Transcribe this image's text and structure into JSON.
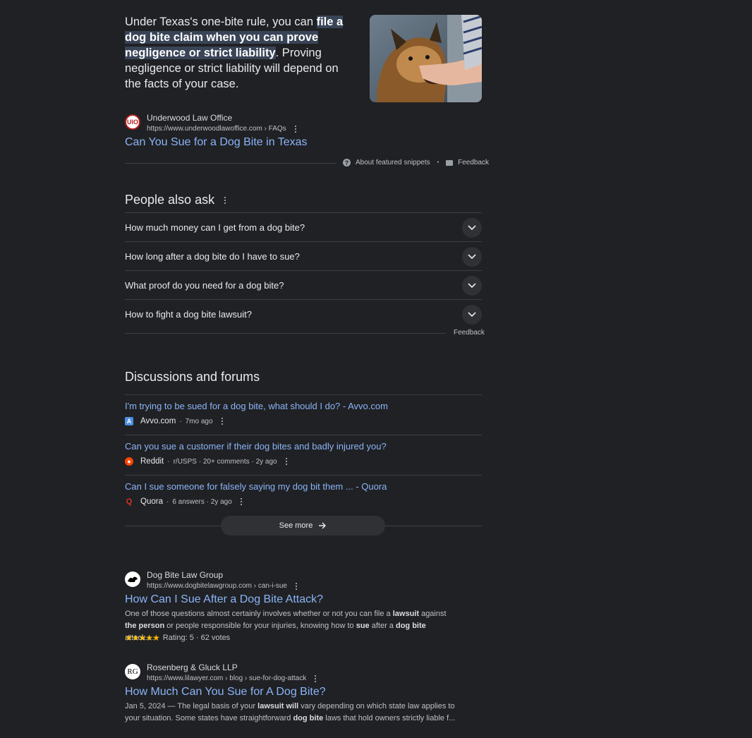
{
  "featured_snippet": {
    "text_before": "Under Texas's one-bite rule, you can ",
    "highlight": "file a dog bite claim when you can prove negligence or strict liability",
    "text_after": ". Proving negligence or strict liability will depend on the facts of your case.",
    "image_alt": "dog-photo",
    "source_name": "Underwood Law Office",
    "source_url": "https://www.underwoodlawoffice.com › FAQs",
    "favicon_text": "UlO",
    "title": "Can You Sue for a Dog Bite in Texas",
    "about_label": "About featured snippets",
    "separator": "•",
    "feedback_label": "Feedback"
  },
  "people_also_ask": {
    "heading": "People also ask",
    "questions": [
      "How much money can I get from a dog bite?",
      "How long after a dog bite do I have to sue?",
      "What proof do you need for a dog bite?",
      "How to fight a dog bite lawsuit?"
    ],
    "feedback_label": "Feedback"
  },
  "discussions": {
    "heading": "Discussions and forums",
    "items": [
      {
        "title": "I'm trying to be sued for a dog bite, what should I do? - Avvo.com",
        "site": "Avvo.com",
        "meta": "7mo ago",
        "icon": "avvo-icon"
      },
      {
        "title": "Can you sue a customer if their dog bites and badly injured you?",
        "site": "Reddit",
        "meta": "r/USPS · 20+ comments · 2y ago",
        "icon": "reddit-icon"
      },
      {
        "title": "Can I sue someone for falsely saying my dog bit them ... - Quora",
        "site": "Quora",
        "meta": "6 answers · 2y ago",
        "icon": "quora-icon"
      }
    ],
    "see_more": "See more"
  },
  "results": [
    {
      "source_name": "Dog Bite Law Group",
      "source_url": "https://www.dogbitelawgroup.com › can-i-sue",
      "title": "How Can I Sue After a Dog Bite Attack?",
      "rating_stars": "★★★★★",
      "rating_text": "Rating: 5 · 62 votes"
    },
    {
      "source_name": "Rosenberg & Gluck LLP",
      "source_url": "https://www.lilawyer.com › blog › sue-for-dog-attack",
      "title": "How Much Can You Sue for A Dog Bite?",
      "date": "Jan 5, 2024 — "
    }
  ],
  "colors": {
    "background": "#202124",
    "link": "#8ab4f8",
    "text": "#e8eaed",
    "highlight": "#394457",
    "star": "#fbbc04"
  }
}
